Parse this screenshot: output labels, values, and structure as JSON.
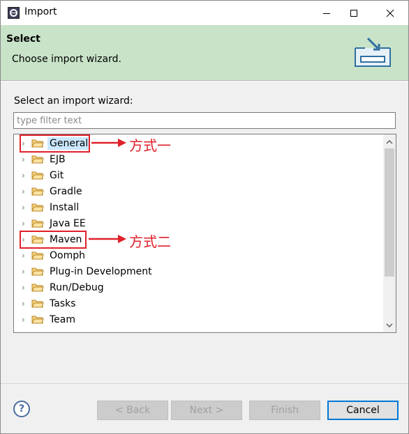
{
  "window": {
    "title": "Import"
  },
  "header": {
    "title": "Select",
    "description": "Choose import wizard."
  },
  "main": {
    "label": "Select an import wizard:",
    "filter_placeholder": "type filter text",
    "tree_items": [
      {
        "label": "General",
        "selected": true
      },
      {
        "label": "EJB"
      },
      {
        "label": "Git"
      },
      {
        "label": "Gradle"
      },
      {
        "label": "Install"
      },
      {
        "label": "Java EE"
      },
      {
        "label": "Maven"
      },
      {
        "label": "Oomph"
      },
      {
        "label": "Plug-in Development"
      },
      {
        "label": "Run/Debug"
      },
      {
        "label": "Tasks"
      },
      {
        "label": "Team"
      }
    ]
  },
  "annotations": {
    "method1": "方式一",
    "method2": "方式二"
  },
  "buttons": {
    "back": "< Back",
    "next": "Next >",
    "finish": "Finish",
    "cancel": "Cancel",
    "help": "?"
  },
  "colors": {
    "header_bg": "#c8e3c8",
    "annotation": "#e0202a",
    "selection": "#cce8ff"
  }
}
